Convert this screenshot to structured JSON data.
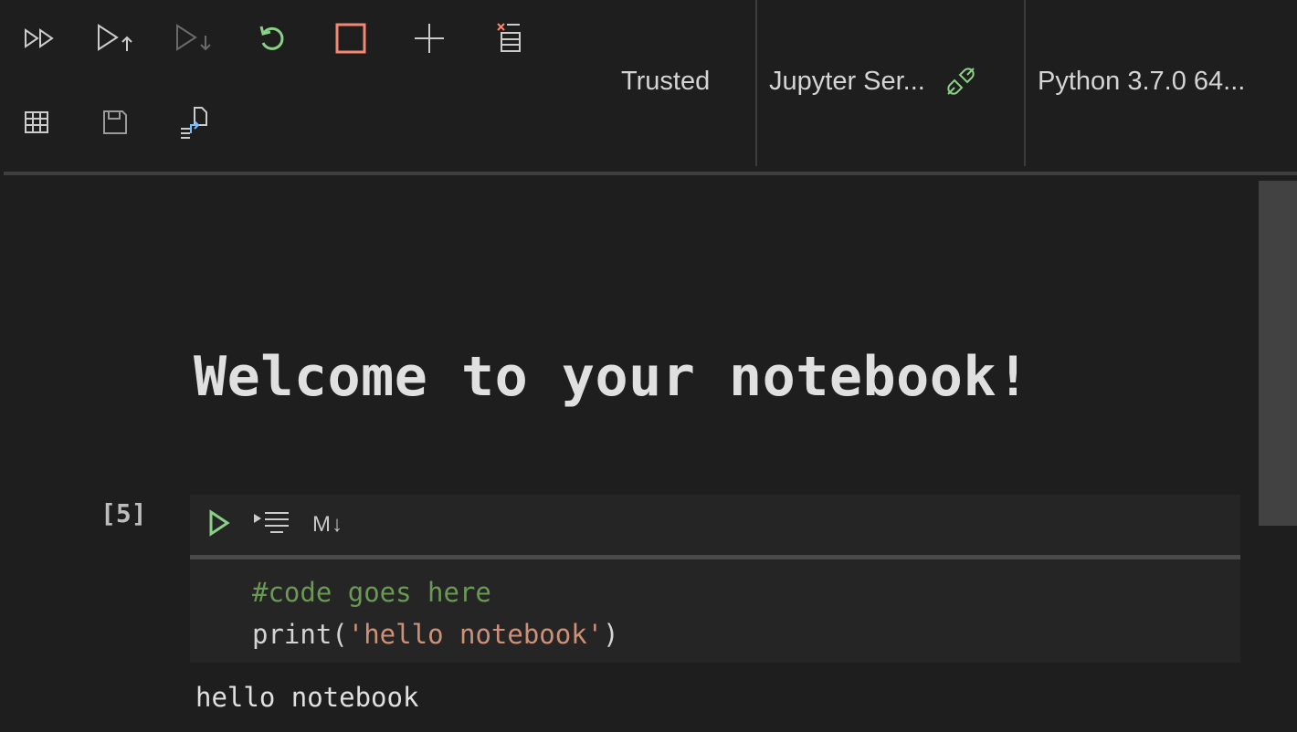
{
  "toolbar": {
    "buttons_row1": [
      {
        "name": "run-all-icon"
      },
      {
        "name": "run-above-icon"
      },
      {
        "name": "run-below-icon"
      },
      {
        "name": "restart-kernel-icon"
      },
      {
        "name": "interrupt-kernel-icon"
      },
      {
        "name": "add-cell-icon"
      },
      {
        "name": "clear-outputs-icon"
      }
    ],
    "buttons_row2": [
      {
        "name": "variables-grid-icon"
      },
      {
        "name": "save-icon"
      },
      {
        "name": "export-icon"
      }
    ],
    "trusted_label": "Trusted",
    "server_label": "Jupyter Ser...",
    "kernel_label": "Python 3.7.0 64...",
    "colors": {
      "run": "#89d185",
      "restart": "#89d185",
      "interrupt": "#f48771",
      "connected": "#89d185",
      "export_accent": "#75beff"
    }
  },
  "notebook": {
    "markdown_heading": "Welcome to your notebook!",
    "cell": {
      "execution_count": "[5]",
      "toolbar": {
        "markdown_toggle_label": "M↓"
      },
      "code_lines": [
        {
          "comment": "#code goes here"
        },
        {
          "func": "print(",
          "string": "'hello notebook'",
          "close": ")"
        }
      ],
      "output": "hello notebook"
    }
  }
}
